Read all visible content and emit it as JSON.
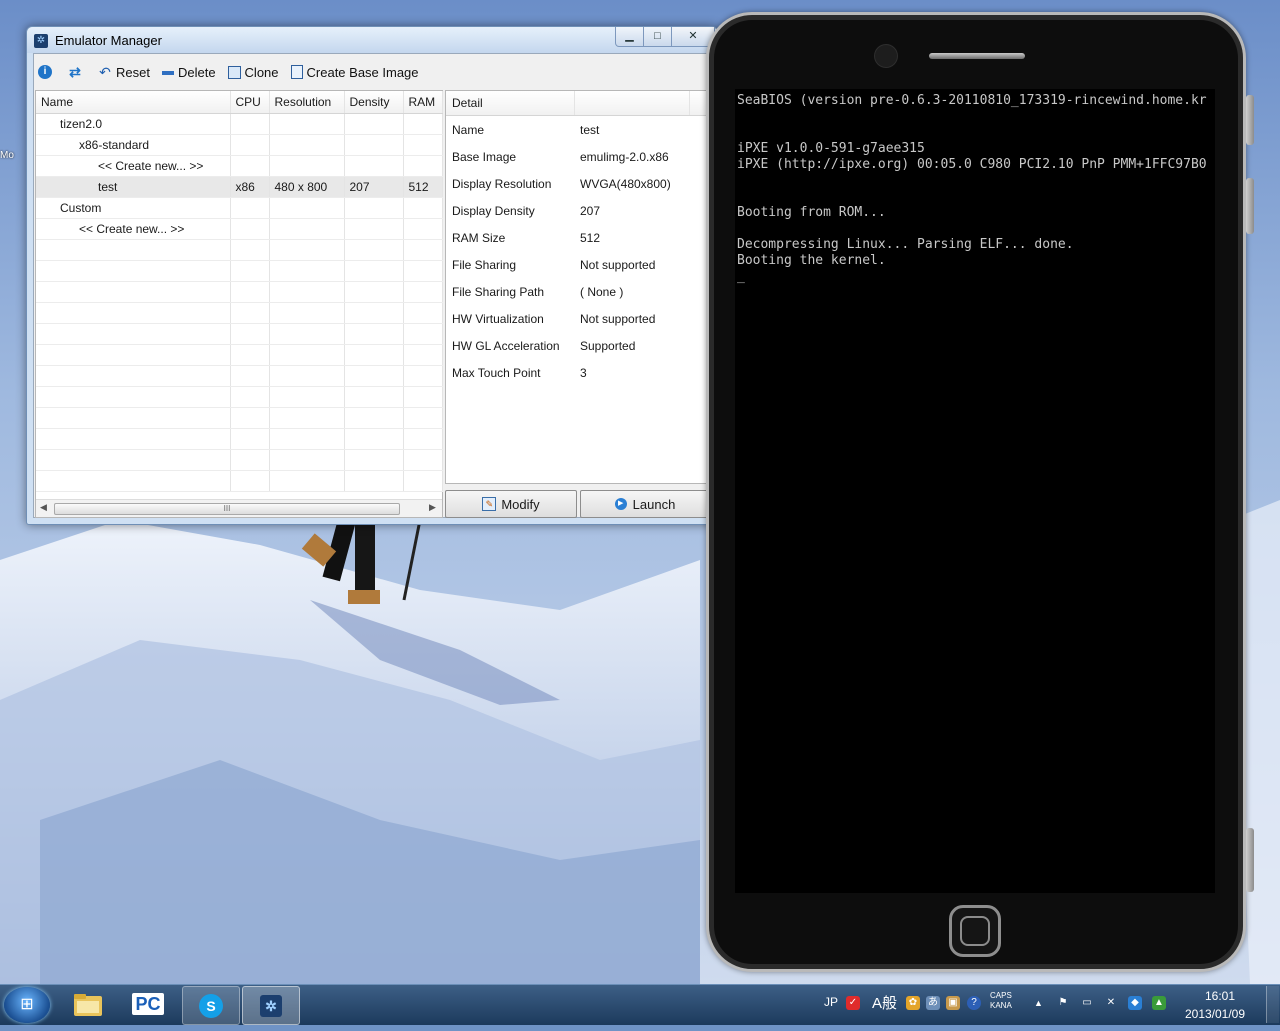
{
  "desktop": {
    "sliver_label": "Mo"
  },
  "emulator_manager": {
    "title": "Emulator Manager",
    "caption_buttons": {
      "minimize": "▁",
      "maximize": "□",
      "close": "✕"
    },
    "toolbar": {
      "info_icon": "info-icon",
      "refresh_icon": "refresh-icon",
      "reset_label": "Reset",
      "delete_label": "Delete",
      "clone_label": "Clone",
      "create_base_label": "Create Base Image"
    },
    "tree": {
      "columns": [
        "Name",
        "CPU",
        "Resolution",
        "Density",
        "RAM"
      ],
      "rows": [
        {
          "name": "tizen2.0",
          "cpu": "",
          "resolution": "",
          "density": "",
          "ram": ""
        },
        {
          "name": "x86-standard",
          "cpu": "",
          "resolution": "",
          "density": "",
          "ram": ""
        },
        {
          "name": "<< Create new... >>",
          "cpu": "",
          "resolution": "",
          "density": "",
          "ram": ""
        },
        {
          "name": "test",
          "cpu": "x86",
          "resolution": "480 x 800",
          "density": "207",
          "ram": "512"
        },
        {
          "name": "Custom",
          "cpu": "",
          "resolution": "",
          "density": "",
          "ram": ""
        },
        {
          "name": "<< Create new... >>",
          "cpu": "",
          "resolution": "",
          "density": "",
          "ram": ""
        }
      ],
      "scroll_thumb_glyph": "III",
      "scroll_left": "◀",
      "scroll_right": "▶"
    },
    "detail": {
      "header": "Detail",
      "rows": [
        {
          "label": "Name",
          "value": "test"
        },
        {
          "label": "Base Image",
          "value": "emulimg-2.0.x86"
        },
        {
          "label": "Display Resolution",
          "value": "WVGA(480x800)"
        },
        {
          "label": "Display Density",
          "value": "207"
        },
        {
          "label": "RAM Size",
          "value": "512"
        },
        {
          "label": "File Sharing",
          "value": "Not supported"
        },
        {
          "label": "File Sharing Path",
          "value": "( None )"
        },
        {
          "label": "HW Virtualization",
          "value": "Not supported"
        },
        {
          "label": "HW GL Acceleration",
          "value": "Supported"
        },
        {
          "label": "Max Touch Point",
          "value": "3"
        }
      ],
      "modify_label": "Modify",
      "launch_label": "Launch"
    }
  },
  "phone": {
    "console_lines": [
      "SeaBIOS (version pre-0.6.3-20110810_173319-rincewind.home.kr",
      "iPXE v1.0.0-591-g7aee315",
      "iPXE (http://ipxe.org) 00:05.0 C980 PCI2.10 PnP PMM+1FFC97B0",
      "Booting from ROM...",
      "Decompressing Linux... Parsing ELF... done.",
      "Booting the kernel.",
      "_"
    ]
  },
  "taskbar": {
    "start_glyph": "⊞",
    "pc_label": "PC",
    "skype_glyph": "S",
    "emulator_glyph": "✲",
    "tray_lang": "JP",
    "tray_ime": "A般",
    "tray_caps": "CAPS",
    "tray_kana": "KANA",
    "time": "16:01",
    "date": "2013/01/09"
  }
}
